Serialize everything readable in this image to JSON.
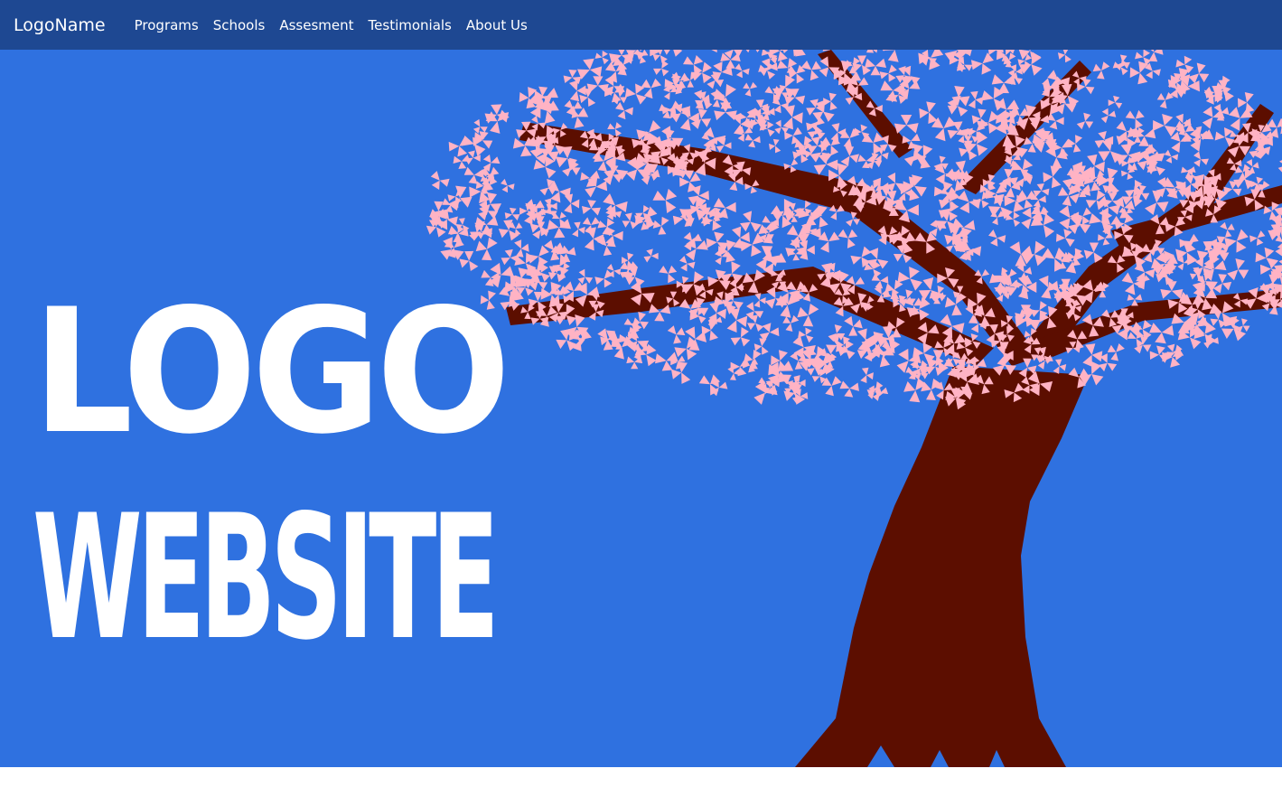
{
  "navbar": {
    "brand": "LogoName",
    "links": [
      {
        "label": "Programs"
      },
      {
        "label": "Schools"
      },
      {
        "label": "Assesment"
      },
      {
        "label": "Testimonials"
      },
      {
        "label": "About Us"
      }
    ]
  },
  "hero": {
    "line1": "LOGO",
    "line2": "WEBSITE",
    "colors": {
      "background": "#2f71e0",
      "trunk": "#5c0e00",
      "blossom": "#ffb3c4",
      "navbar": "#1e4892"
    },
    "image": "cherry-blossom-tree"
  }
}
